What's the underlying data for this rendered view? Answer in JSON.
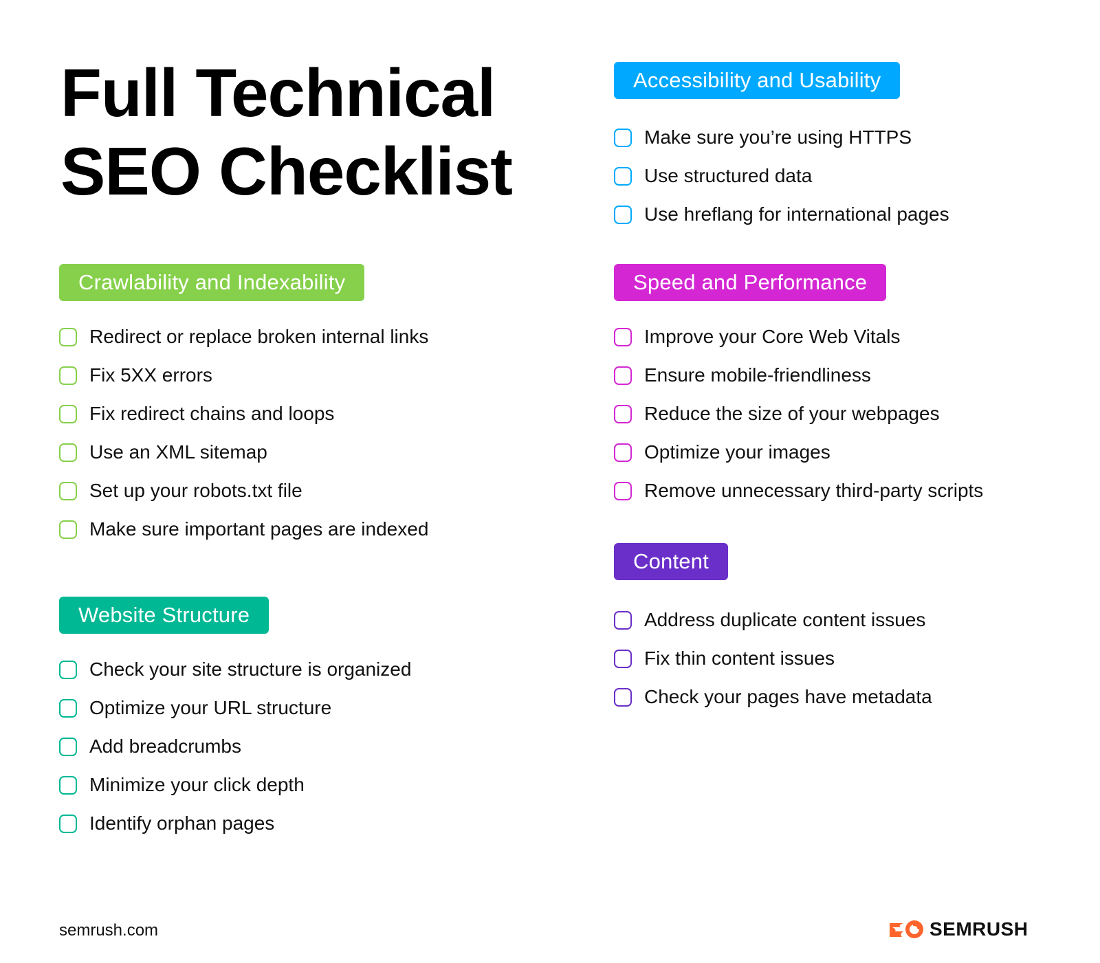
{
  "title": {
    "line1": "Full Technical",
    "line2": "SEO Checklist"
  },
  "sections": {
    "crawlability": {
      "label": "Crawlability and Indexability",
      "color": "#86d04b",
      "items": [
        "Redirect or replace broken internal links",
        "Fix 5XX errors",
        "Fix redirect chains and loops",
        "Use an XML sitemap",
        "Set up your robots.txt file",
        "Make sure important pages are indexed"
      ]
    },
    "structure": {
      "label": "Website Structure",
      "color": "#00b894",
      "items": [
        "Check your site structure is organized",
        "Optimize your URL structure",
        "Add breadcrumbs",
        "Minimize your click depth",
        "Identify orphan pages"
      ]
    },
    "accessibility": {
      "label": "Accessibility and Usability",
      "color": "#00a9ff",
      "items": [
        "Make sure you’re using HTTPS",
        "Use structured data",
        "Use hreflang for international pages"
      ]
    },
    "speed": {
      "label": "Speed and Performance",
      "color": "#d427d3",
      "items": [
        "Improve your Core Web Vitals",
        "Ensure mobile-friendliness",
        "Reduce the size of your webpages",
        "Optimize your images",
        "Remove unnecessary third-party scripts"
      ]
    },
    "content": {
      "label": "Content",
      "color": "#6a2fc9",
      "items": [
        "Address duplicate content issues",
        "Fix thin content issues",
        "Check your pages have metadata"
      ]
    }
  },
  "footer": {
    "url": "semrush.com",
    "brand": "SEMRUSH",
    "brand_color": "#ff642d"
  }
}
